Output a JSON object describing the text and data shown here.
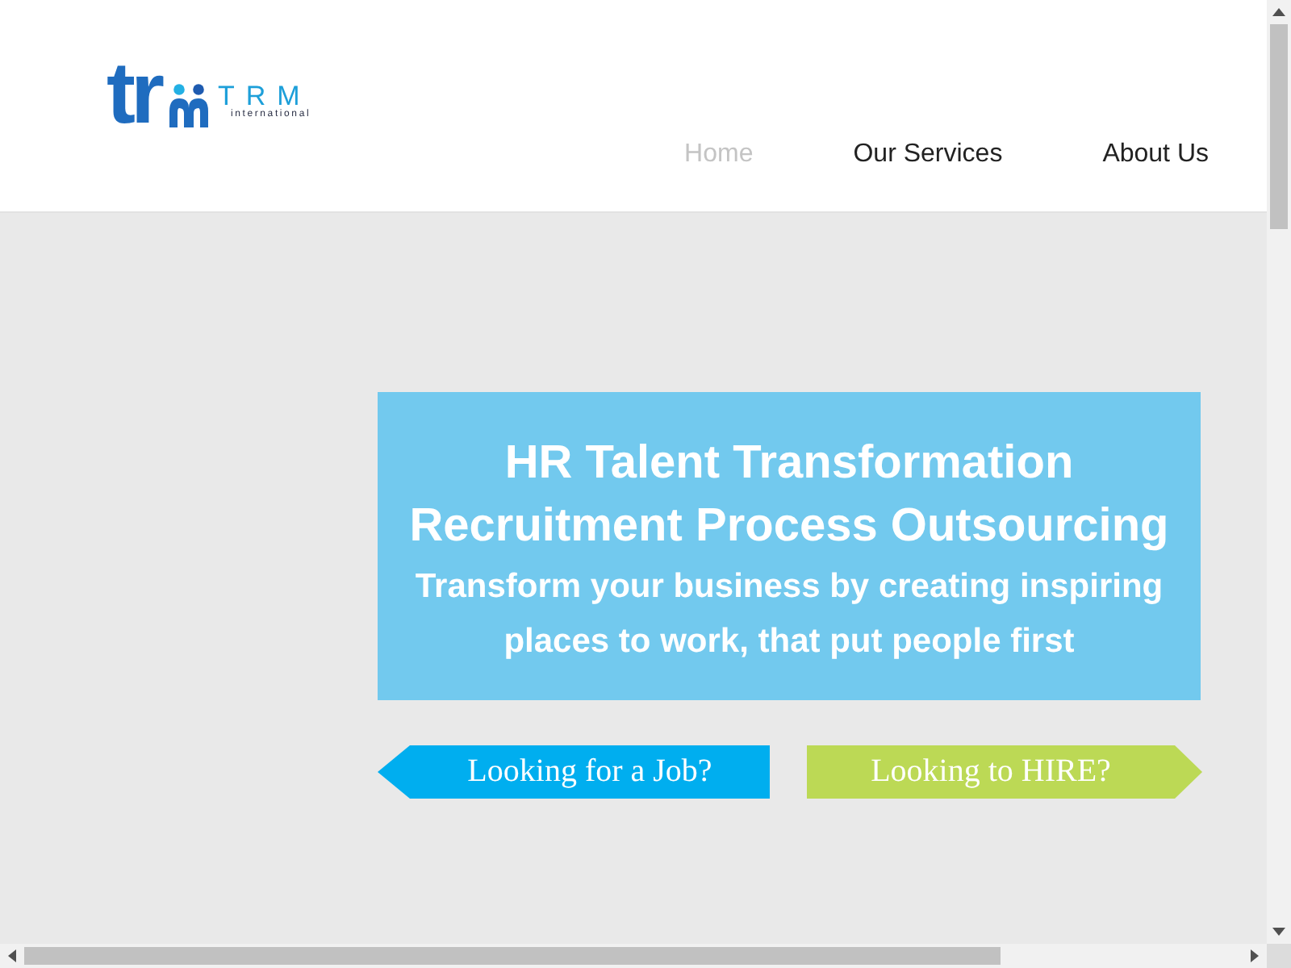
{
  "header": {
    "logo": {
      "mark": "tr",
      "name": "TRM",
      "tagline": "international"
    },
    "nav": [
      {
        "label": "Home",
        "selected": true
      },
      {
        "label": "Our Services",
        "selected": false
      },
      {
        "label": "About Us",
        "selected": false
      }
    ]
  },
  "hero": {
    "headline": [
      "HR Talent Transformation",
      "Recruitment Process Outsourcing"
    ],
    "subheadline": "Transform your business by creating inspiring places to work, that put people first",
    "buttons": [
      {
        "label": "Looking for a Job?",
        "kind": "arrow-left",
        "color": "#00aeef"
      },
      {
        "label": "Looking to HIRE?",
        "kind": "arrow-right",
        "color": "#bcd955"
      }
    ]
  }
}
